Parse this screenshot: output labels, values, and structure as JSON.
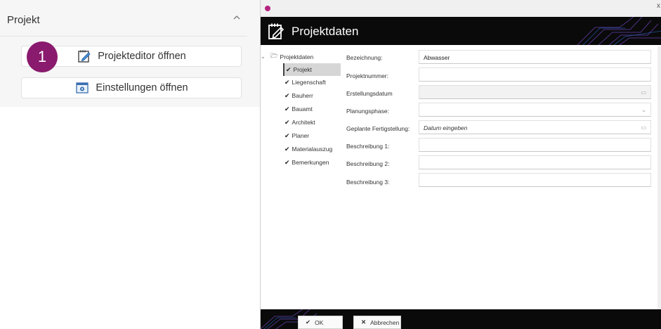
{
  "left_panel": {
    "title": "Projekt",
    "step_badge": "1",
    "buttons": [
      {
        "label": "Projekteditor öffnen",
        "icon": "edit-document-icon"
      },
      {
        "label": "Einstellungen öffnen",
        "icon": "settings-window-icon"
      }
    ]
  },
  "dialog": {
    "title": "Projektdaten",
    "close_glyph": "x",
    "tree": {
      "root": "Projektdaten",
      "items": [
        "Projekt",
        "Liegenschaft",
        "Bauherr",
        "Bauamt",
        "Architekt",
        "Planer",
        "Materialauszug",
        "Bemerkungen"
      ],
      "selected": "Projekt"
    },
    "form": {
      "fields": [
        {
          "label": "Bezeichnung:",
          "value": "Abwasser"
        },
        {
          "label": "Projektnummer:",
          "value": ""
        },
        {
          "label": "Erstellungsdatum",
          "value": ""
        },
        {
          "label": "Planungsphase:",
          "value": ""
        },
        {
          "label": "Geplante Fertigstellung:",
          "value": "Datum eingeben"
        },
        {
          "label": "Beschreibung 1:",
          "value": ""
        },
        {
          "label": "Beschreibung 2:",
          "value": ""
        },
        {
          "label": "Beschreibung 3:",
          "value": ""
        }
      ]
    },
    "footer": {
      "ok_label": "OK",
      "cancel_label": "Abbrechen"
    }
  },
  "colors": {
    "badge": "#8a1a6e",
    "header_bg": "#0a0a0a",
    "accent": "#b5237f"
  }
}
